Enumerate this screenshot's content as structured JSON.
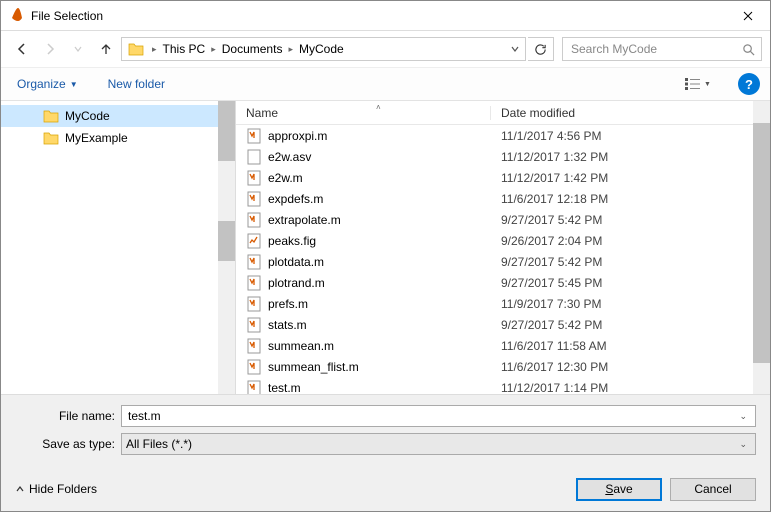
{
  "window": {
    "title": "File Selection"
  },
  "breadcrumb": {
    "segments": [
      "This PC",
      "Documents",
      "MyCode"
    ]
  },
  "search": {
    "placeholder": "Search MyCode"
  },
  "toolbar": {
    "organize": "Organize",
    "new_folder": "New folder"
  },
  "tree": {
    "items": [
      {
        "name": "MyCode",
        "selected": true
      },
      {
        "name": "MyExample",
        "selected": false
      }
    ]
  },
  "columns": {
    "name": "Name",
    "date": "Date modified"
  },
  "files": [
    {
      "name": "approxpi.m",
      "date": "11/1/2017 4:56 PM",
      "type": "m"
    },
    {
      "name": "e2w.asv",
      "date": "11/12/2017 1:32 PM",
      "type": "asv"
    },
    {
      "name": "e2w.m",
      "date": "11/12/2017 1:42 PM",
      "type": "m"
    },
    {
      "name": "expdefs.m",
      "date": "11/6/2017 12:18 PM",
      "type": "m"
    },
    {
      "name": "extrapolate.m",
      "date": "9/27/2017 5:42 PM",
      "type": "m"
    },
    {
      "name": "peaks.fig",
      "date": "9/26/2017 2:04 PM",
      "type": "fig"
    },
    {
      "name": "plotdata.m",
      "date": "9/27/2017 5:42 PM",
      "type": "m"
    },
    {
      "name": "plotrand.m",
      "date": "9/27/2017 5:45 PM",
      "type": "m"
    },
    {
      "name": "prefs.m",
      "date": "11/9/2017 7:30 PM",
      "type": "m"
    },
    {
      "name": "stats.m",
      "date": "9/27/2017 5:42 PM",
      "type": "m"
    },
    {
      "name": "summean.m",
      "date": "11/6/2017 11:58 AM",
      "type": "m"
    },
    {
      "name": "summean_flist.m",
      "date": "11/6/2017 12:30 PM",
      "type": "m"
    },
    {
      "name": "test.m",
      "date": "11/12/2017 1:14 PM",
      "type": "m"
    }
  ],
  "form": {
    "filename_label": "File name:",
    "filename_value": "test.m",
    "saveas_label": "Save as type:",
    "saveas_value": "All Files (*.*)"
  },
  "footer": {
    "hide_folders": "Hide Folders",
    "save": "Save",
    "cancel": "Cancel"
  }
}
